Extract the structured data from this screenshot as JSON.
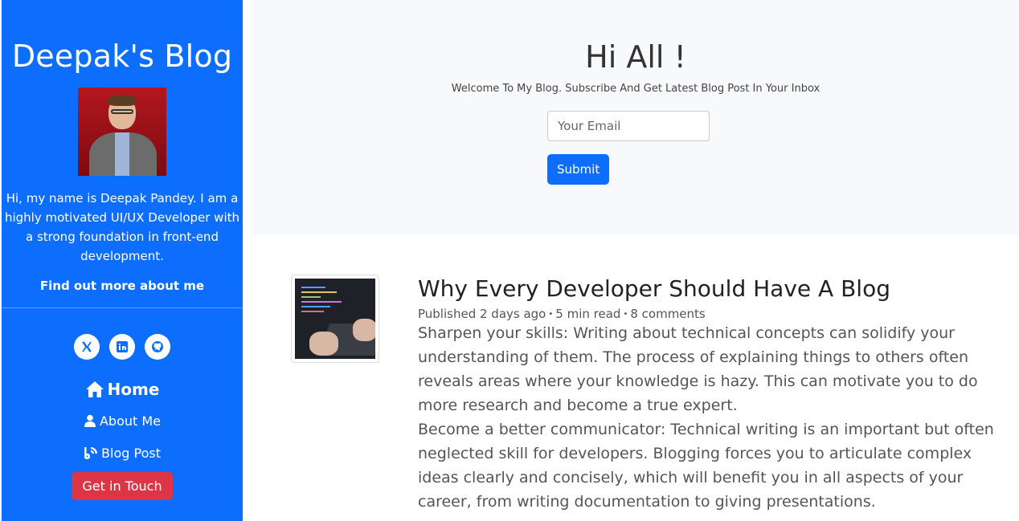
{
  "sidebar": {
    "brand": "Deepak's Blog",
    "bio": "Hi, my name is Deepak Pandey. I am a highly motivated UI/UX Developer with a strong foundation in front-end development.",
    "find_out": "Find out more about me",
    "socials": [
      {
        "icon": "x-twitter-icon"
      },
      {
        "icon": "linkedin-icon"
      },
      {
        "icon": "github-icon"
      }
    ],
    "nav": {
      "home": "Home",
      "about": "About Me",
      "blog": "Blog Post"
    },
    "cta": "Get in Touch",
    "accent": "#0d6efd",
    "cta_color": "#dc3545"
  },
  "hero": {
    "title": "Hi All !",
    "subtitle": "Welcome To My Blog. Subscribe And Get Latest Blog Post In Your Inbox",
    "email_placeholder": "Your Email",
    "submit": "Submit"
  },
  "post": {
    "title": "Why Every Developer Should Have A Blog",
    "published": "Published 2 days ago",
    "read_time": "5 min read",
    "comments": "8 comments",
    "paragraphs": [
      "Sharpen your skills: Writing about technical concepts can solidify your understanding of them. The process of explaining things to others often reveals areas where your knowledge is hazy. This can motivate you to do more research and become a true expert.",
      "Become a better communicator: Technical writing is an important but often neglected skill for developers. Blogging forces you to articulate complex ideas clearly and concisely, which will benefit you in all aspects of your career, from writing documentation to giving presentations."
    ]
  }
}
